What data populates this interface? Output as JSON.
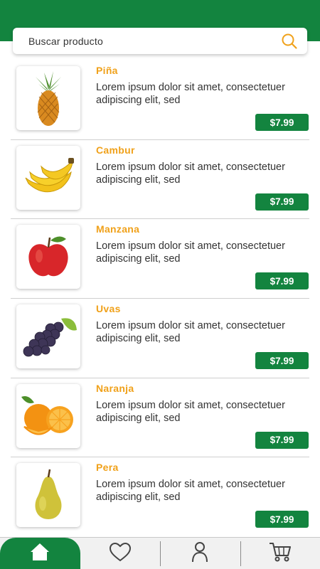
{
  "colors": {
    "primary": "#13843f",
    "accent": "#f0a11a",
    "text": "#333333"
  },
  "search": {
    "placeholder": "Buscar producto",
    "icon": "search-icon"
  },
  "products": [
    {
      "name": "Piña",
      "description": "Lorem ipsum dolor sit amet, consectetuer adipiscing elit, sed",
      "price": "$7.99",
      "image": "pineapple"
    },
    {
      "name": "Cambur",
      "description": "Lorem ipsum dolor sit amet, consectetuer adipiscing elit, sed",
      "price": "$7.99",
      "image": "banana"
    },
    {
      "name": "Manzana",
      "description": "Lorem ipsum dolor sit amet, consectetuer adipiscing elit, sed",
      "price": "$7.99",
      "image": "apple"
    },
    {
      "name": "Uvas",
      "description": "Lorem ipsum dolor sit amet, consectetuer adipiscing elit, sed",
      "price": "$7.99",
      "image": "grapes"
    },
    {
      "name": "Naranja",
      "description": "Lorem ipsum dolor sit amet, consectetuer adipiscing elit, sed",
      "price": "$7.99",
      "image": "orange"
    },
    {
      "name": "Pera",
      "description": "Lorem ipsum dolor sit amet, consectetuer adipiscing elit, sed",
      "price": "$7.99",
      "image": "pear"
    }
  ],
  "nav": {
    "items": [
      {
        "icon": "home-icon",
        "active": true
      },
      {
        "icon": "heart-icon"
      },
      {
        "icon": "user-icon"
      },
      {
        "icon": "cart-icon"
      }
    ]
  }
}
